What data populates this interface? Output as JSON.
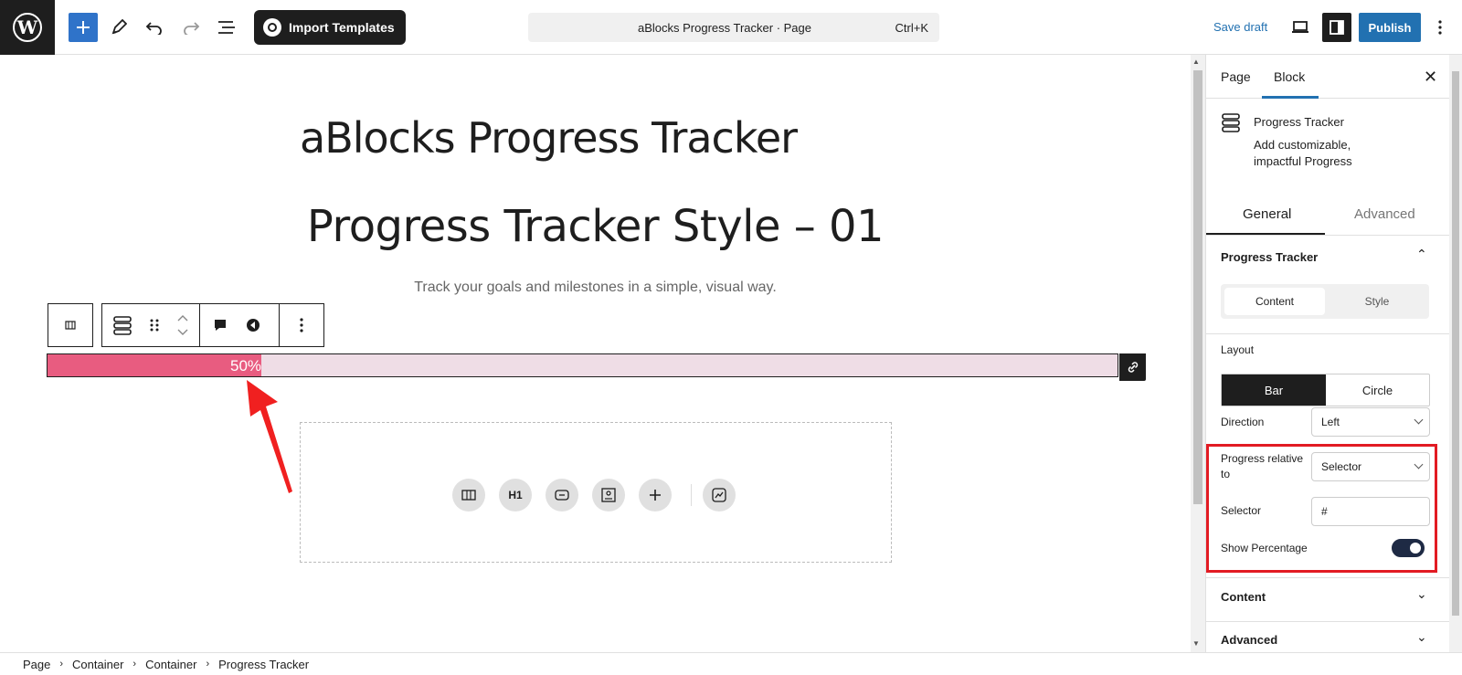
{
  "topbar": {
    "import_label": "Import Templates",
    "doc_title": "aBlocks Progress Tracker · Page",
    "shortcut": "Ctrl+K",
    "save_draft": "Save draft",
    "publish": "Publish"
  },
  "canvas": {
    "page_title": "aBlocks Progress Tracker",
    "heading": "Progress Tracker Style – 01",
    "subheading": "Track your goals and milestones in a simple, visual way.",
    "progress": {
      "percent": 50,
      "label": "50%",
      "fill_color": "#e85c80",
      "track_color": "#efdde6"
    },
    "appender_icons": [
      "columns-icon",
      "heading-icon",
      "button-icon",
      "image-text-icon",
      "plus-icon",
      "chart-icon"
    ],
    "appender_heading_label": "H1"
  },
  "breadcrumb": [
    "Page",
    "Container",
    "Container",
    "Progress Tracker"
  ],
  "sidebar": {
    "tabs": [
      "Page",
      "Block"
    ],
    "active_tab": "Block",
    "block_name": "Progress Tracker",
    "block_desc": "Add customizable, impactful Progress",
    "sub_tabs": [
      "General",
      "Advanced"
    ],
    "section_title": "Progress Tracker",
    "content_style": [
      "Content",
      "Style"
    ],
    "layout_label": "Layout",
    "layout_options": [
      "Bar",
      "Circle"
    ],
    "direction_label": "Direction",
    "direction_value": "Left",
    "relative_label": "Progress relative to",
    "relative_value": "Selector",
    "selector_label": "Selector",
    "selector_value": "#",
    "show_pct_label": "Show Percentage",
    "show_pct_on": true,
    "content_section": "Content",
    "advanced_section": "Advanced"
  },
  "colors": {
    "accent": "#2271b1",
    "highlight": "#e21b23",
    "annotation_arrow": "#f02020"
  }
}
